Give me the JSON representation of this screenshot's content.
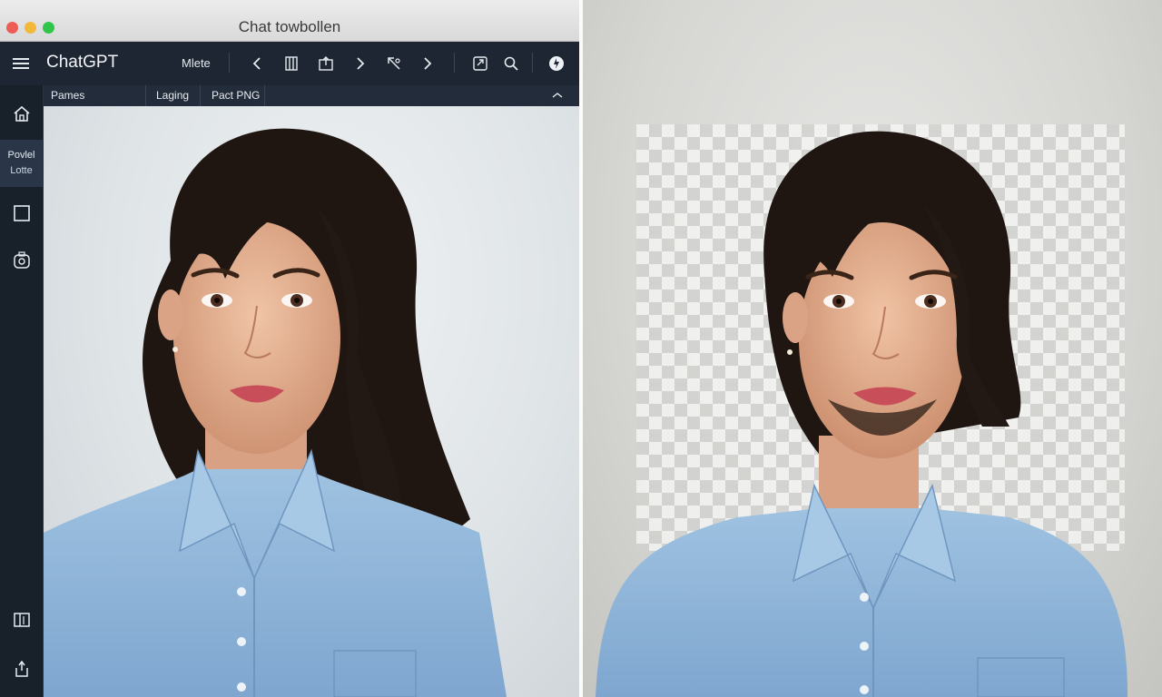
{
  "window": {
    "title": "Chat towbollen",
    "traffic_lights": {
      "close": "#ee5d55",
      "minimize": "#f3b83a",
      "maximize": "#31c549"
    }
  },
  "toolbar": {
    "brand": "ChatGPT",
    "mode_label": "Mlete",
    "icons": [
      "menu-icon",
      "chevron-left-icon",
      "columns-icon",
      "import-icon",
      "chevron-right-icon",
      "cursor-cut-icon",
      "chevron-right-icon",
      "export-icon",
      "search-icon",
      "profile-icon"
    ]
  },
  "subtabs": [
    {
      "label": "Pames"
    },
    {
      "label": "Laging"
    },
    {
      "label": "Pact PNG"
    }
  ],
  "sidebar": {
    "items": [
      {
        "icon": "home-icon"
      },
      {
        "label_line1": "Povlel",
        "label_line2": "Lotte"
      },
      {
        "icon": "square-icon"
      },
      {
        "icon": "image-badge-icon"
      },
      {
        "icon": "columns-panel-icon"
      },
      {
        "icon": "share-icon"
      }
    ]
  },
  "images": {
    "original": {
      "subject": "portrait",
      "shirt_color": "#8fb6d9",
      "hair_color": "#1f1612"
    },
    "processed": {
      "subject": "portrait with transparent background",
      "checker_color": "#d2d2d0"
    }
  },
  "colors": {
    "toolbar_bg": "#1e2633",
    "sidebar_bg": "#182029",
    "accent_active": "#2a3648"
  }
}
